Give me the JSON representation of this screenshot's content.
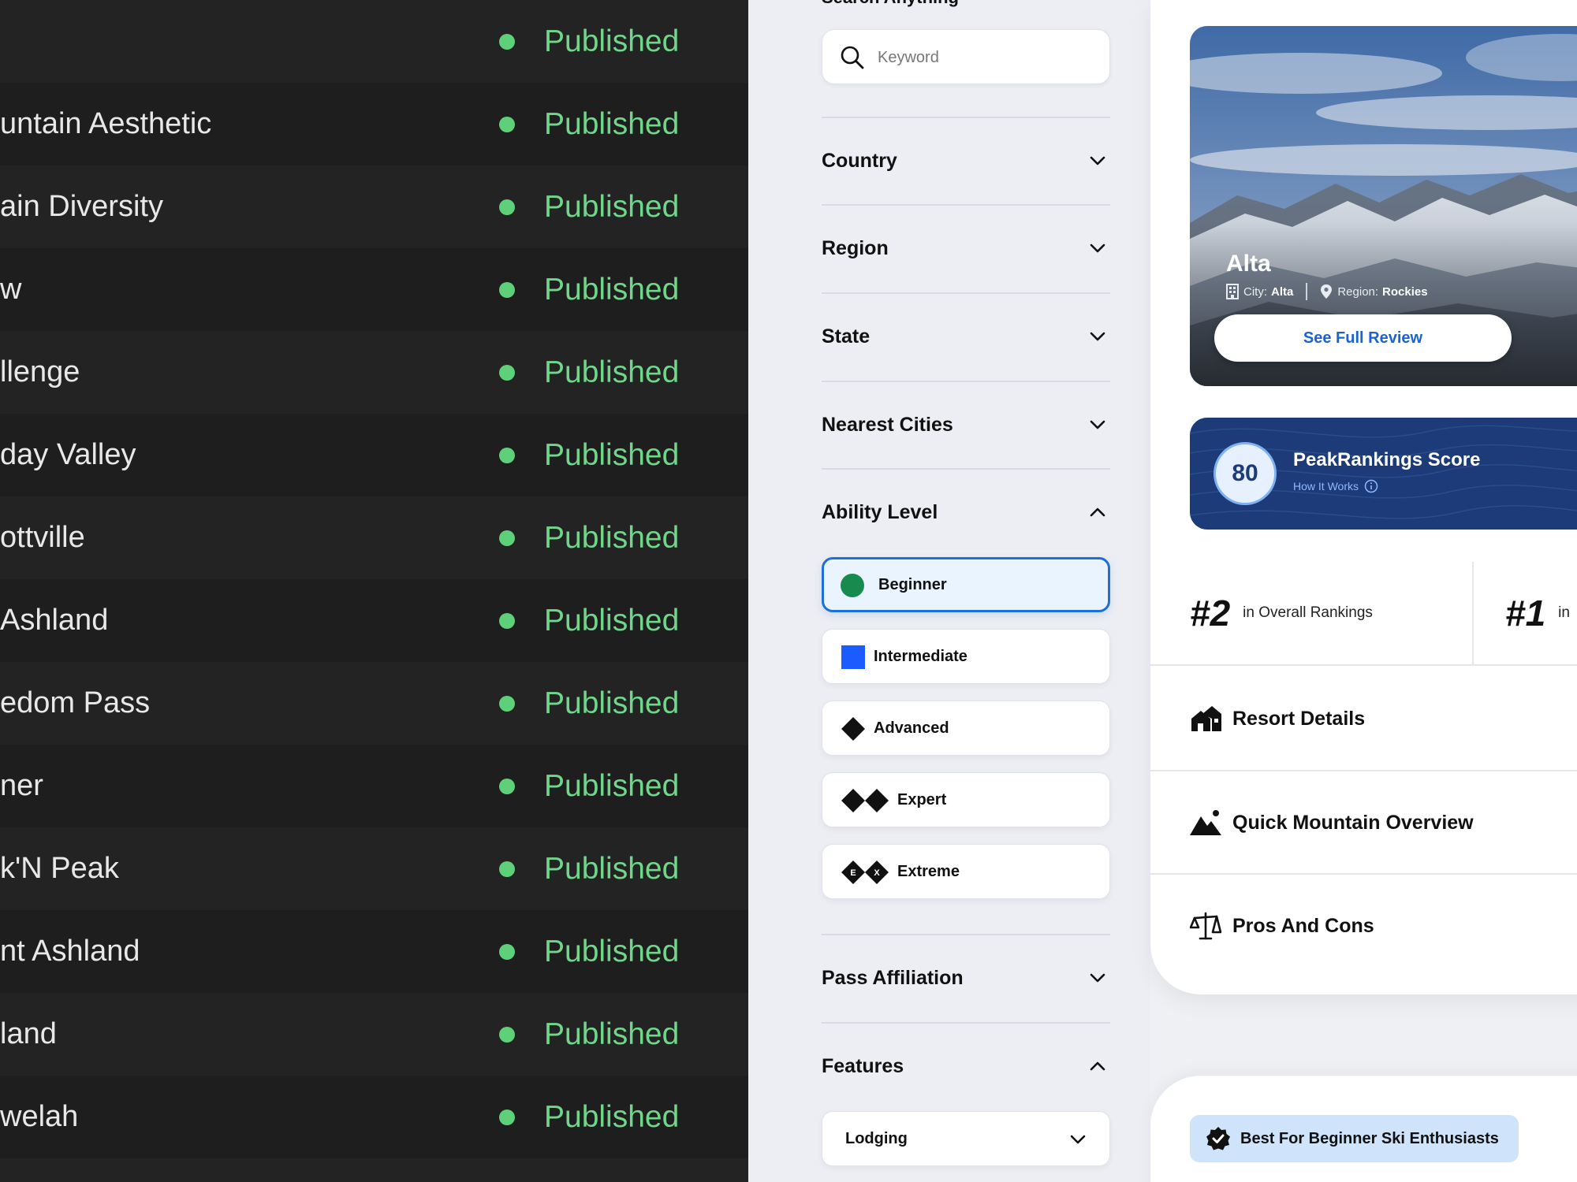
{
  "resort_list": {
    "rows": [
      {
        "name": "",
        "status": "Published"
      },
      {
        "name": "untain Aesthetic",
        "status": "Published"
      },
      {
        "name": "ain Diversity",
        "status": "Published"
      },
      {
        "name": "w",
        "status": "Published"
      },
      {
        "name": "llenge",
        "status": "Published"
      },
      {
        "name": "day Valley",
        "status": "Published"
      },
      {
        "name": "ottville",
        "status": "Published"
      },
      {
        "name": "Ashland",
        "status": "Published"
      },
      {
        "name": "edom Pass",
        "status": "Published"
      },
      {
        "name": "ner",
        "status": "Published"
      },
      {
        "name": "k'N Peak",
        "status": "Published"
      },
      {
        "name": "nt Ashland",
        "status": "Published"
      },
      {
        "name": "land",
        "status": "Published"
      },
      {
        "name": "welah",
        "status": "Published"
      }
    ],
    "status_color": "#6fd68a"
  },
  "filters": {
    "search_label": "Search Anything",
    "search_placeholder": "Keyword",
    "sections": {
      "country": "Country",
      "region": "Region",
      "state": "State",
      "nearest_cities": "Nearest Cities",
      "ability_level": "Ability Level",
      "pass_affiliation": "Pass Affiliation",
      "features": "Features"
    },
    "ability_levels": [
      {
        "label": "Beginner",
        "icon": "green-circle-icon",
        "selected": true
      },
      {
        "label": "Intermediate",
        "icon": "blue-square-icon",
        "selected": false
      },
      {
        "label": "Advanced",
        "icon": "black-diamond-icon",
        "selected": false
      },
      {
        "label": "Expert",
        "icon": "double-black-diamond-icon",
        "selected": false
      },
      {
        "label": "Extreme",
        "icon": "extreme-diamond-icon",
        "selected": false
      }
    ],
    "ability_extreme_marks": [
      "E",
      "X"
    ],
    "features_dropdown": "Lodging",
    "accent_color": "#1f6fd8"
  },
  "resort": {
    "name": "Alta",
    "city_label": "City:",
    "city": "Alta",
    "region_label": "Region:",
    "region": "Rockies",
    "review_button": "See Full Review",
    "score": "80",
    "score_title": "PeakRankings Score",
    "how_it_works": "How It Works",
    "rankings": [
      {
        "rank": "#2",
        "label": "in Overall Rankings"
      },
      {
        "rank": "#1",
        "label": "in"
      }
    ],
    "menu": [
      {
        "label": "Resort Details",
        "icon": "house-icon"
      },
      {
        "label": "Quick Mountain Overview",
        "icon": "mountain-icon"
      },
      {
        "label": "Pros And Cons",
        "icon": "scales-icon"
      }
    ],
    "best_for": "Best For Beginner Ski Enthusiasts",
    "score_panel_color": "#1c3b78"
  }
}
